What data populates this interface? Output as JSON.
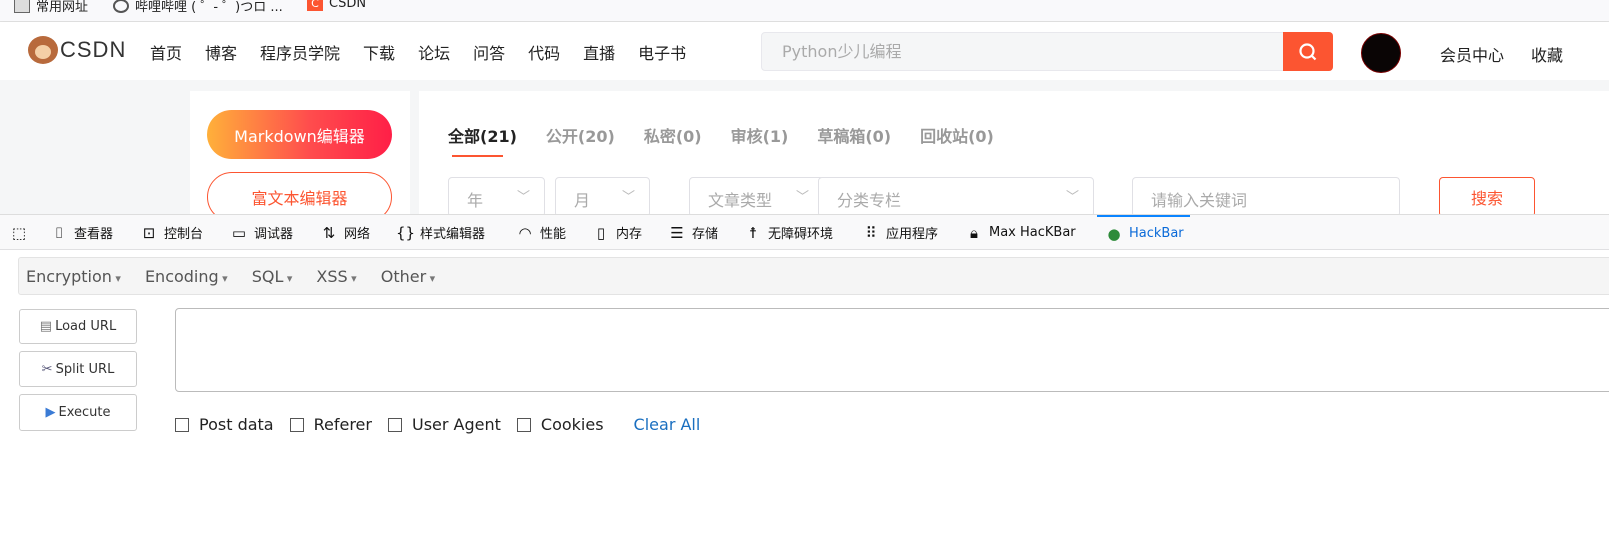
{
  "bookmarks": [
    {
      "label": "常用网址",
      "icon": "folder-icon"
    },
    {
      "label": "哔哩哔哩 ( ゜- ゜)つロ ...",
      "icon": "globe-icon"
    },
    {
      "label": "CSDN",
      "icon": "csdn-icon"
    }
  ],
  "header": {
    "logo": "CSDN",
    "nav": [
      "首页",
      "博客",
      "程序员学院",
      "下载",
      "论坛",
      "问答",
      "代码",
      "直播",
      "电子书"
    ],
    "search_placeholder": "Python少儿编程",
    "links": [
      "会员中心",
      "收藏"
    ]
  },
  "editor": {
    "markdown": "Markdown编辑器",
    "richtext": "富文本编辑器"
  },
  "tabs": [
    "全部(21)",
    "公开(20)",
    "私密(0)",
    "审核(1)",
    "草稿箱(0)",
    "回收站(0)"
  ],
  "filters": {
    "year": "年",
    "month": "月",
    "type": "文章类型",
    "column": "分类专栏",
    "keyword_placeholder": "请输入关键词",
    "search": "搜索"
  },
  "devtools": [
    {
      "label": "",
      "icon": "pick-element-icon"
    },
    {
      "label": "查看器",
      "icon": "inspector-icon"
    },
    {
      "label": "控制台",
      "icon": "console-icon"
    },
    {
      "label": "调试器",
      "icon": "debugger-icon"
    },
    {
      "label": "网络",
      "icon": "network-icon"
    },
    {
      "label": "样式编辑器",
      "icon": "style-editor-icon"
    },
    {
      "label": "性能",
      "icon": "performance-icon"
    },
    {
      "label": "内存",
      "icon": "memory-icon"
    },
    {
      "label": "存储",
      "icon": "storage-icon"
    },
    {
      "label": "无障碍环境",
      "icon": "accessibility-icon"
    },
    {
      "label": "应用程序",
      "icon": "application-icon"
    },
    {
      "label": "Max HacKBar",
      "icon": "lock-icon"
    },
    {
      "label": "HackBar",
      "icon": "hackbar-icon",
      "active": true
    }
  ],
  "hackbar": {
    "menu": [
      "Encryption",
      "Encoding",
      "SQL",
      "XSS",
      "Other"
    ],
    "buttons": [
      "Load URL",
      "Split URL",
      "Execute"
    ],
    "url_value": "",
    "options": [
      "Post data",
      "Referer",
      "User Agent",
      "Cookies"
    ],
    "clear": "Clear All"
  },
  "colors": {
    "accent": "#fc5531",
    "link": "#1a6fc0",
    "devtools_active": "#0a84ff"
  }
}
